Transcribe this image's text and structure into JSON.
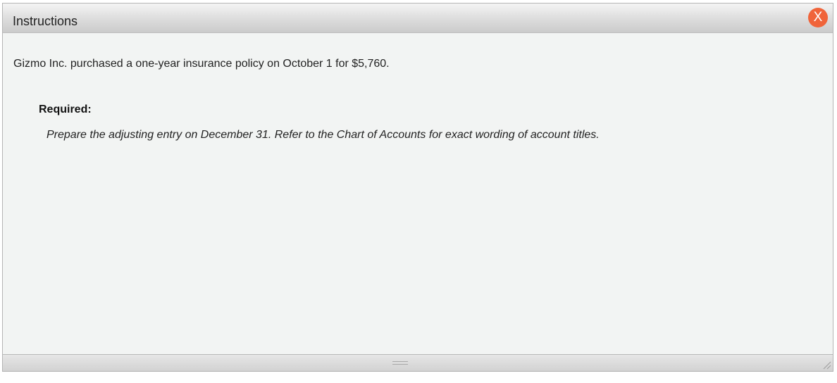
{
  "dialog": {
    "title": "Instructions",
    "close_label": "X",
    "close_color": "#f0643a"
  },
  "content": {
    "intro": "Gizmo Inc. purchased a one-year insurance policy on October 1 for $5,760.",
    "required_label": "Required:",
    "task": "Prepare the adjusting entry on December 31. Refer to the Chart of Accounts for exact wording of account titles."
  },
  "icons": {
    "close": "close-icon",
    "grip": "drag-handle-icon",
    "resize": "resize-corner-icon"
  }
}
